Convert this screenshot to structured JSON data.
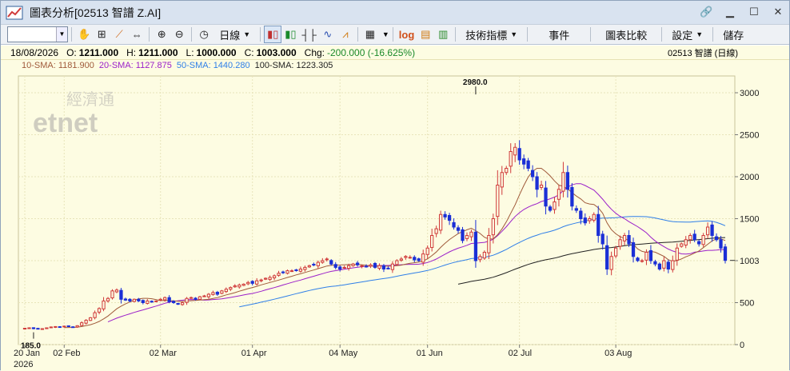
{
  "window": {
    "title": "圖表分析[02513 智譜 Z.AI]",
    "app_icon": "chart-app-icon",
    "controls": [
      "pin-icon",
      "minimize-icon",
      "maximize-icon",
      "close-icon"
    ]
  },
  "toolbar": {
    "symbol_value": "",
    "interval_label": "日線",
    "indicator_label": "技術指標",
    "events_label": "事件",
    "compare_label": "圖表比較",
    "settings_label": "設定",
    "save_label": "儲存",
    "log_label": "log"
  },
  "info": {
    "date": "18/08/2026",
    "open_label": "O:",
    "open": "1211.000",
    "high_label": "H:",
    "high": "1211.000",
    "low_label": "L:",
    "low": "1000.000",
    "close_label": "C:",
    "close": "1003.000",
    "chg_label": "Chg:",
    "chg": "-200.000 (-16.625%)",
    "symbol_right": "02513  智譜 (日線)"
  },
  "sma": {
    "sma10": "10-SMA: 1181.900",
    "sma20": "20-SMA: 1127.875",
    "sma50": "50-SMA: 1440.280",
    "sma100": "100-SMA: 1223.305"
  },
  "colors": {
    "up": "#d03a3a",
    "down": "#1b2fd6",
    "sma10": "#a05a3a",
    "sma20": "#9b1fc9",
    "sma50": "#2f7fe8",
    "sma100": "#222222",
    "background": "#fdfce2",
    "grid": "#e8e4ba"
  },
  "watermark": {
    "cn": "經濟通",
    "en": "etnet"
  },
  "chart_data": {
    "type": "candlestick",
    "ylim": [
      0,
      3200
    ],
    "yticks": [
      0,
      500,
      1000,
      1500,
      2000,
      2500,
      3000
    ],
    "ytick_labels": [
      "0",
      "500",
      "1003",
      "1500",
      "2000",
      "2500",
      "3000"
    ],
    "x_ticks": [
      {
        "i": 0,
        "label": "20 Jan"
      },
      {
        "i": 9,
        "label": "02 Feb"
      },
      {
        "i": 31,
        "label": "02 Mar"
      },
      {
        "i": 52,
        "label": "01 Apr"
      },
      {
        "i": 72,
        "label": "04 May"
      },
      {
        "i": 92,
        "label": "01 Jun"
      },
      {
        "i": 113,
        "label": "02 Jul"
      },
      {
        "i": 135,
        "label": "03 Aug"
      }
    ],
    "year_label": "2026",
    "annotations": [
      {
        "i": 103,
        "value": 2980,
        "label": "2980.0",
        "pos": "above"
      },
      {
        "i": 2,
        "value": 185,
        "label": "185.0",
        "pos": "below"
      }
    ],
    "last_price": 1003,
    "closes": [
      195,
      200,
      190,
      185,
      190,
      200,
      210,
      215,
      210,
      220,
      215,
      210,
      225,
      260,
      290,
      320,
      380,
      430,
      520,
      550,
      640,
      650,
      540,
      530,
      520,
      540,
      520,
      500,
      520,
      510,
      520,
      540,
      560,
      510,
      500,
      480,
      500,
      550,
      560,
      540,
      570,
      580,
      600,
      620,
      600,
      640,
      660,
      680,
      700,
      710,
      720,
      740,
      730,
      760,
      770,
      790,
      800,
      820,
      850,
      860,
      880,
      880,
      890,
      900,
      920,
      940,
      950,
      980,
      1000,
      1020,
      960,
      920,
      900,
      920,
      940,
      960,
      950,
      940,
      930,
      950,
      920,
      940,
      900,
      910,
      960,
      1000,
      1020,
      1050,
      1040,
      1010,
      1000,
      1080,
      1150,
      1300,
      1380,
      1550,
      1520,
      1480,
      1400,
      1360,
      1240,
      1300,
      1340,
      1000,
      1050,
      1100,
      1300,
      1500,
      1900,
      2050,
      2100,
      2300,
      2350,
      2200,
      2150,
      2100,
      2000,
      1850,
      1900,
      1650,
      1600,
      1700,
      1850,
      2050,
      1850,
      1650,
      1600,
      1500,
      1450,
      1500,
      1550,
      1300,
      1200,
      900,
      1050,
      1150,
      1250,
      1300,
      1200,
      1050,
      1000,
      1000,
      1100,
      1000,
      960,
      900,
      1000,
      900,
      1000,
      1150,
      1200,
      1250,
      1300,
      1250,
      1200,
      1300,
      1400,
      1300,
      1250,
      1150,
      1003
    ]
  }
}
